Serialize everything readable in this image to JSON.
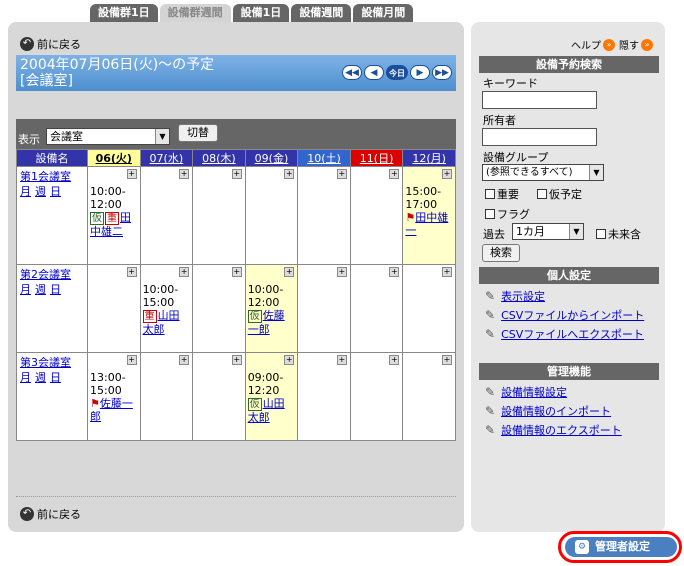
{
  "tabs": [
    "設備群1日",
    "設備群週間",
    "設備1日",
    "設備週間",
    "設備月間"
  ],
  "active_tab": 1,
  "back_label": "前に戻る",
  "title": {
    "line1": "2004年07月06日(火)～の予定",
    "line2": "[会議室]",
    "today_label": "今日"
  },
  "filter": {
    "label": "表示",
    "selected": "会議室",
    "switch_label": "切替"
  },
  "table": {
    "header_facility": "設備名",
    "days": [
      "06(火)",
      "07(水)",
      "08(木)",
      "09(金)",
      "10(土)",
      "11(日)",
      "12(月)"
    ],
    "links": [
      "月",
      "週",
      "日"
    ],
    "rows": [
      {
        "name": "第1会議室",
        "events": [
          {
            "day": 0,
            "time": "10:00-12:00",
            "tags": [
              "仮",
              "重"
            ],
            "user": "田中雄二"
          },
          {
            "day": 6,
            "time": "15:00-17:00",
            "flag": true,
            "user": "田中雄一"
          }
        ]
      },
      {
        "name": "第2会議室",
        "events": [
          {
            "day": 1,
            "time": "10:00-15:00",
            "tags": [
              "重"
            ],
            "user": "山田太郎"
          },
          {
            "day": 3,
            "time": "10:00-12:00",
            "tags": [
              "仮"
            ],
            "user": "佐藤一郎"
          }
        ]
      },
      {
        "name": "第3会議室",
        "events": [
          {
            "day": 0,
            "time": "13:00-15:00",
            "flag": true,
            "user": "佐藤一郎"
          },
          {
            "day": 3,
            "time": "09:00-12:20",
            "tags": [
              "仮"
            ],
            "user": "山田太郎"
          }
        ]
      }
    ]
  },
  "sidebar": {
    "help": "ヘルプ",
    "hide": "隠す",
    "search": {
      "heading": "設備予約検索",
      "keyword_label": "キーワード",
      "owner_label": "所有者",
      "group_label": "設備グループ",
      "group_selected": "(参照できるすべて)",
      "important": "重要",
      "tentative": "仮予定",
      "flag": "フラグ",
      "past_label": "過去",
      "past_selected": "1カ月",
      "unfinished": "未来含",
      "search_button": "検索"
    },
    "personal": {
      "heading": "個人設定",
      "items": [
        "表示設定",
        "CSVファイルからインポート",
        "CSVファイルへエクスポート"
      ]
    },
    "admin": {
      "heading": "管理機能",
      "items": [
        "設備情報設定",
        "設備情報のインポート",
        "設備情報のエクスポート"
      ]
    }
  },
  "admin_button": "管理者設定",
  "colors": {
    "header_blue": "#3333aa",
    "today_yellow": "#ffff99",
    "sunday_red": "#dd0000",
    "event_yellow": "#ffffcc",
    "admin_ring": "#ff0000"
  }
}
